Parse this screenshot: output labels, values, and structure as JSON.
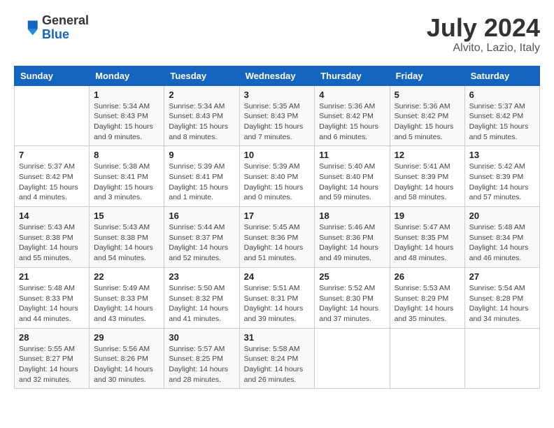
{
  "header": {
    "logo": {
      "general": "General",
      "blue": "Blue"
    },
    "month": "July 2024",
    "location": "Alvito, Lazio, Italy"
  },
  "weekdays": [
    "Sunday",
    "Monday",
    "Tuesday",
    "Wednesday",
    "Thursday",
    "Friday",
    "Saturday"
  ],
  "weeks": [
    [
      {
        "day": "",
        "sunrise": "",
        "sunset": "",
        "daylight": ""
      },
      {
        "day": "1",
        "sunrise": "Sunrise: 5:34 AM",
        "sunset": "Sunset: 8:43 PM",
        "daylight": "Daylight: 15 hours and 9 minutes."
      },
      {
        "day": "2",
        "sunrise": "Sunrise: 5:34 AM",
        "sunset": "Sunset: 8:43 PM",
        "daylight": "Daylight: 15 hours and 8 minutes."
      },
      {
        "day": "3",
        "sunrise": "Sunrise: 5:35 AM",
        "sunset": "Sunset: 8:43 PM",
        "daylight": "Daylight: 15 hours and 7 minutes."
      },
      {
        "day": "4",
        "sunrise": "Sunrise: 5:36 AM",
        "sunset": "Sunset: 8:42 PM",
        "daylight": "Daylight: 15 hours and 6 minutes."
      },
      {
        "day": "5",
        "sunrise": "Sunrise: 5:36 AM",
        "sunset": "Sunset: 8:42 PM",
        "daylight": "Daylight: 15 hours and 5 minutes."
      },
      {
        "day": "6",
        "sunrise": "Sunrise: 5:37 AM",
        "sunset": "Sunset: 8:42 PM",
        "daylight": "Daylight: 15 hours and 5 minutes."
      }
    ],
    [
      {
        "day": "7",
        "sunrise": "Sunrise: 5:37 AM",
        "sunset": "Sunset: 8:42 PM",
        "daylight": "Daylight: 15 hours and 4 minutes."
      },
      {
        "day": "8",
        "sunrise": "Sunrise: 5:38 AM",
        "sunset": "Sunset: 8:41 PM",
        "daylight": "Daylight: 15 hours and 3 minutes."
      },
      {
        "day": "9",
        "sunrise": "Sunrise: 5:39 AM",
        "sunset": "Sunset: 8:41 PM",
        "daylight": "Daylight: 15 hours and 1 minute."
      },
      {
        "day": "10",
        "sunrise": "Sunrise: 5:39 AM",
        "sunset": "Sunset: 8:40 PM",
        "daylight": "Daylight: 15 hours and 0 minutes."
      },
      {
        "day": "11",
        "sunrise": "Sunrise: 5:40 AM",
        "sunset": "Sunset: 8:40 PM",
        "daylight": "Daylight: 14 hours and 59 minutes."
      },
      {
        "day": "12",
        "sunrise": "Sunrise: 5:41 AM",
        "sunset": "Sunset: 8:39 PM",
        "daylight": "Daylight: 14 hours and 58 minutes."
      },
      {
        "day": "13",
        "sunrise": "Sunrise: 5:42 AM",
        "sunset": "Sunset: 8:39 PM",
        "daylight": "Daylight: 14 hours and 57 minutes."
      }
    ],
    [
      {
        "day": "14",
        "sunrise": "Sunrise: 5:43 AM",
        "sunset": "Sunset: 8:38 PM",
        "daylight": "Daylight: 14 hours and 55 minutes."
      },
      {
        "day": "15",
        "sunrise": "Sunrise: 5:43 AM",
        "sunset": "Sunset: 8:38 PM",
        "daylight": "Daylight: 14 hours and 54 minutes."
      },
      {
        "day": "16",
        "sunrise": "Sunrise: 5:44 AM",
        "sunset": "Sunset: 8:37 PM",
        "daylight": "Daylight: 14 hours and 52 minutes."
      },
      {
        "day": "17",
        "sunrise": "Sunrise: 5:45 AM",
        "sunset": "Sunset: 8:36 PM",
        "daylight": "Daylight: 14 hours and 51 minutes."
      },
      {
        "day": "18",
        "sunrise": "Sunrise: 5:46 AM",
        "sunset": "Sunset: 8:36 PM",
        "daylight": "Daylight: 14 hours and 49 minutes."
      },
      {
        "day": "19",
        "sunrise": "Sunrise: 5:47 AM",
        "sunset": "Sunset: 8:35 PM",
        "daylight": "Daylight: 14 hours and 48 minutes."
      },
      {
        "day": "20",
        "sunrise": "Sunrise: 5:48 AM",
        "sunset": "Sunset: 8:34 PM",
        "daylight": "Daylight: 14 hours and 46 minutes."
      }
    ],
    [
      {
        "day": "21",
        "sunrise": "Sunrise: 5:48 AM",
        "sunset": "Sunset: 8:33 PM",
        "daylight": "Daylight: 14 hours and 44 minutes."
      },
      {
        "day": "22",
        "sunrise": "Sunrise: 5:49 AM",
        "sunset": "Sunset: 8:33 PM",
        "daylight": "Daylight: 14 hours and 43 minutes."
      },
      {
        "day": "23",
        "sunrise": "Sunrise: 5:50 AM",
        "sunset": "Sunset: 8:32 PM",
        "daylight": "Daylight: 14 hours and 41 minutes."
      },
      {
        "day": "24",
        "sunrise": "Sunrise: 5:51 AM",
        "sunset": "Sunset: 8:31 PM",
        "daylight": "Daylight: 14 hours and 39 minutes."
      },
      {
        "day": "25",
        "sunrise": "Sunrise: 5:52 AM",
        "sunset": "Sunset: 8:30 PM",
        "daylight": "Daylight: 14 hours and 37 minutes."
      },
      {
        "day": "26",
        "sunrise": "Sunrise: 5:53 AM",
        "sunset": "Sunset: 8:29 PM",
        "daylight": "Daylight: 14 hours and 35 minutes."
      },
      {
        "day": "27",
        "sunrise": "Sunrise: 5:54 AM",
        "sunset": "Sunset: 8:28 PM",
        "daylight": "Daylight: 14 hours and 34 minutes."
      }
    ],
    [
      {
        "day": "28",
        "sunrise": "Sunrise: 5:55 AM",
        "sunset": "Sunset: 8:27 PM",
        "daylight": "Daylight: 14 hours and 32 minutes."
      },
      {
        "day": "29",
        "sunrise": "Sunrise: 5:56 AM",
        "sunset": "Sunset: 8:26 PM",
        "daylight": "Daylight: 14 hours and 30 minutes."
      },
      {
        "day": "30",
        "sunrise": "Sunrise: 5:57 AM",
        "sunset": "Sunset: 8:25 PM",
        "daylight": "Daylight: 14 hours and 28 minutes."
      },
      {
        "day": "31",
        "sunrise": "Sunrise: 5:58 AM",
        "sunset": "Sunset: 8:24 PM",
        "daylight": "Daylight: 14 hours and 26 minutes."
      },
      {
        "day": "",
        "sunrise": "",
        "sunset": "",
        "daylight": ""
      },
      {
        "day": "",
        "sunrise": "",
        "sunset": "",
        "daylight": ""
      },
      {
        "day": "",
        "sunrise": "",
        "sunset": "",
        "daylight": ""
      }
    ]
  ]
}
